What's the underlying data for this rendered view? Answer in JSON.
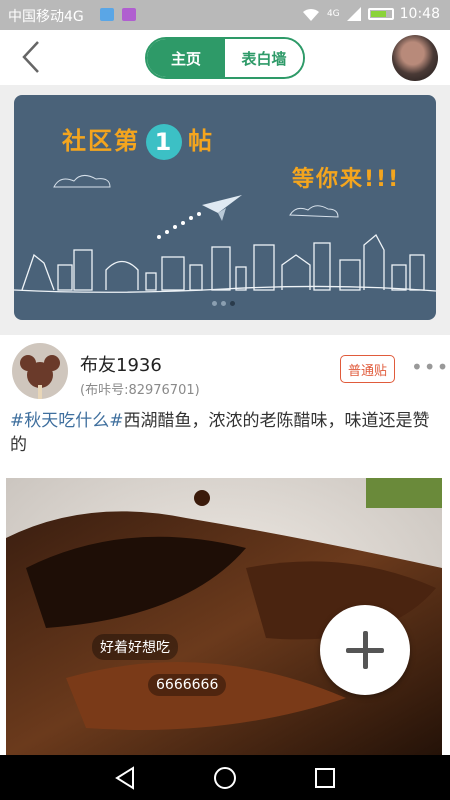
{
  "status_bar": {
    "carrier": "中国移动4G",
    "network": "4G",
    "time": "10:48",
    "icons": [
      "wifi-icon",
      "signal-icon",
      "battery-icon"
    ]
  },
  "header": {
    "back_icon": "chevron-left-icon",
    "tabs": [
      {
        "label": "主页",
        "active": true
      },
      {
        "label": "表白墙",
        "active": false
      }
    ],
    "accent_color": "#2e9a68"
  },
  "banner": {
    "title_before": "社区第",
    "number": "1",
    "title_after": "帖",
    "subtitle": "等你来!!!",
    "page_count": 3,
    "active_page": 3
  },
  "post": {
    "username": "布友1936",
    "user_id": "(布咔号:82976701)",
    "post_type": "普通贴",
    "more_icon": "more-dots-icon",
    "hashtag": "#秋天吃什么#",
    "text": "西湖醋鱼，浓浓的老陈醋味，味道还是赞的",
    "danmu": [
      "好着好想吃",
      "6666666"
    ]
  },
  "fab": {
    "icon": "plus-icon"
  },
  "navbar": {
    "icons": [
      "back-triangle-icon",
      "home-circle-icon",
      "recent-square-icon"
    ]
  }
}
